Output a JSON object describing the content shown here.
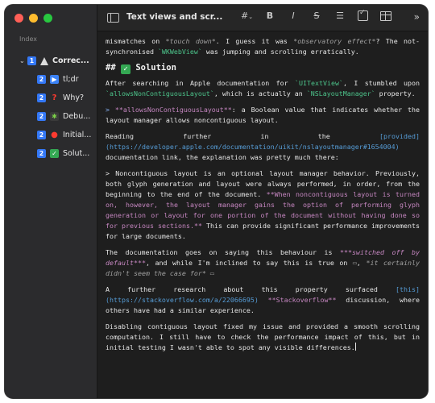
{
  "sidebar": {
    "index_label": "Index",
    "root": {
      "number": "1",
      "label": "Correc..."
    },
    "items": [
      {
        "number": "2",
        "label": "tl;dr",
        "icon": "play-icon"
      },
      {
        "number": "2",
        "label": "Why?",
        "icon": "question-icon"
      },
      {
        "number": "2",
        "label": "Debu...",
        "icon": "bug-icon"
      },
      {
        "number": "2",
        "label": "Initial...",
        "icon": "pin-icon"
      },
      {
        "number": "2",
        "label": "Solut...",
        "icon": "checkmark-icon"
      }
    ]
  },
  "toolbar": {
    "title": "Text views and scr...",
    "heading_btn": "#",
    "bold_btn": "B",
    "italic_btn": "I",
    "strike_btn": "S"
  },
  "editor": {
    "line1a": "mismatches on ",
    "line1b": "*touch down*",
    "line1c": ". I guess it was ",
    "line1d": "*observatory effect*",
    "line1e": "? The not-synchronised ",
    "line1f": "`WKWebView`",
    "line1g": " was jumping and scrolling erratically.",
    "h2_hash": "##",
    "h2_text": "Solution",
    "p2a": "After searching in Apple documentation for ",
    "p2b": "`UITextView`",
    "p2c": ", I stumbled upon ",
    "p2d": "`allowsNonContiguousLayout`",
    "p2e": ", which is actually an ",
    "p2f": "`NSLayoutManager`",
    "p2g": " property.",
    "p3a": "> ",
    "p3b": "**allowsNonContiguousLayout**",
    "p3c": ": a Boolean value that indicates whether the layout manager allows noncontiguous layout.",
    "p4a": "Reading further in the ",
    "p4b": "[provided](https://developer.apple.com/documentation/uikit/nslayoutmanager#1654004)",
    "p4c": " documentation link, the explanation was pretty much there:",
    "p5a": "> Noncontiguous layout is an optional layout manager behavior. Previously, both glyph generation and layout were always performed, in order, from the beginning to the end of the document. ",
    "p5b": "**When noncontiguous layout is turned on, however, the layout manager gains the option of performing glyph generation or layout for one portion of the document without having done so for previous sections.**",
    "p5c": " This can provide significant performance improvements for large documents.",
    "p6a": "The documentation goes on saying this behaviour is ",
    "p6b": "***switched off by default***",
    "p6c": ", and while I'm inclined to say this is true on ",
    "p6d": "*it certainly didn't seem the case for*",
    "p7a": "A further research about this property surfaced ",
    "p7b": "[this](https://stackoverflow.com/a/22066695)",
    "p7c": " ",
    "p7d": "**Stackoverflow**",
    "p7e": " discussion, where others have had a similar experience.",
    "p8": "Disabling contiguous layout fixed my issue and provided a smooth scrolling computation. I still have to check the performance impact of this, but in initial testing I wasn't able to spot any visible differences."
  }
}
